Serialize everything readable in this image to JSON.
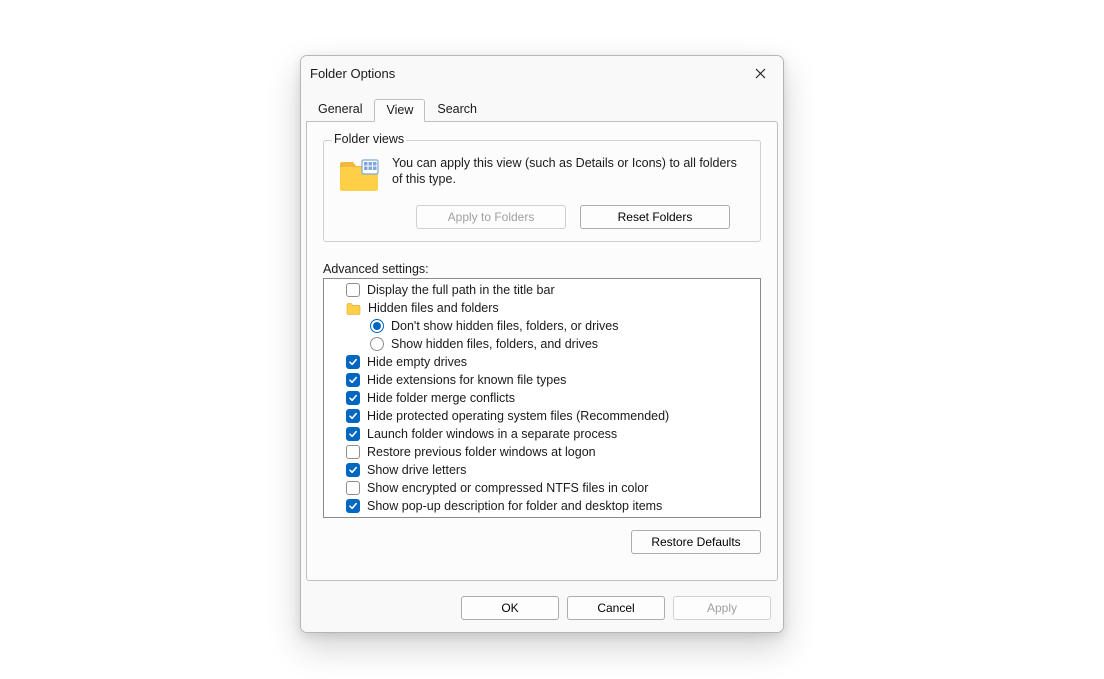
{
  "dialog_title": "Folder Options",
  "tabs": {
    "general": "General",
    "view": "View",
    "search": "Search"
  },
  "folder_views": {
    "group_label": "Folder views",
    "description": "You can apply this view (such as Details or Icons) to all folders of this type.",
    "apply_label": "Apply to Folders",
    "reset_label": "Reset Folders"
  },
  "advanced": {
    "label": "Advanced settings:",
    "items": [
      {
        "type": "checkbox",
        "checked": false,
        "label": "Display the full path in the title bar"
      },
      {
        "type": "group",
        "label": "Hidden files and folders"
      },
      {
        "type": "radio",
        "selected": true,
        "label": "Don't show hidden files, folders, or drives"
      },
      {
        "type": "radio",
        "selected": false,
        "label": "Show hidden files, folders, and drives"
      },
      {
        "type": "checkbox",
        "checked": true,
        "label": "Hide empty drives"
      },
      {
        "type": "checkbox",
        "checked": true,
        "label": "Hide extensions for known file types"
      },
      {
        "type": "checkbox",
        "checked": true,
        "label": "Hide folder merge conflicts"
      },
      {
        "type": "checkbox",
        "checked": true,
        "label": "Hide protected operating system files (Recommended)"
      },
      {
        "type": "checkbox",
        "checked": true,
        "label": "Launch folder windows in a separate process"
      },
      {
        "type": "checkbox",
        "checked": false,
        "label": "Restore previous folder windows at logon"
      },
      {
        "type": "checkbox",
        "checked": true,
        "label": "Show drive letters"
      },
      {
        "type": "checkbox",
        "checked": false,
        "label": "Show encrypted or compressed NTFS files in color"
      },
      {
        "type": "checkbox",
        "checked": true,
        "label": "Show pop-up description for folder and desktop items"
      }
    ],
    "restore_defaults_label": "Restore Defaults"
  },
  "footer": {
    "ok": "OK",
    "cancel": "Cancel",
    "apply": "Apply"
  }
}
